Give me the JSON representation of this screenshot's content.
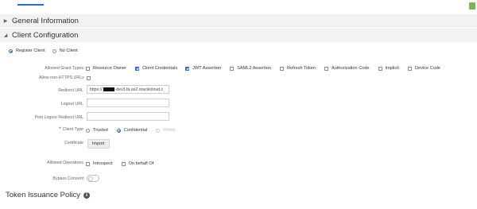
{
  "sections": {
    "general_information": "General Information",
    "client_configuration": "Client Configuration"
  },
  "client_mode": {
    "options": [
      {
        "label": "Register Client",
        "selected": true
      },
      {
        "label": "No Client",
        "selected": false
      }
    ]
  },
  "grant_types": {
    "label": "Allowed Grant Types",
    "options": [
      {
        "label": "Resource Owner",
        "checked": false
      },
      {
        "label": "Client Credentials",
        "checked": true
      },
      {
        "label": "JWT Assertion",
        "checked": true
      },
      {
        "label": "SAML2 Assertion",
        "checked": false
      },
      {
        "label": "Refresh Token",
        "checked": false
      },
      {
        "label": "Authorization Code",
        "checked": false
      },
      {
        "label": "Implicit",
        "checked": false
      },
      {
        "label": "Device Code",
        "checked": false
      }
    ]
  },
  "allow_non_https": {
    "label": "Allow non-HTTPS URLs",
    "checked": false
  },
  "redirect_url": {
    "label": "Redirect URL",
    "value_prefix": "https://",
    "value_suffix": "-dev3.fa.us2.oraclecloud.c"
  },
  "logout_url": {
    "label": "Logout URL",
    "value": ""
  },
  "post_logout_redirect_url": {
    "label": "Post Logout Redirect URL",
    "value": ""
  },
  "client_type": {
    "required_mark": "*",
    "label": "Client Type",
    "options": [
      {
        "label": "Trusted",
        "selected": false,
        "disabled": false
      },
      {
        "label": "Confidential",
        "selected": true,
        "disabled": false
      },
      {
        "label": "Public",
        "selected": false,
        "disabled": true
      }
    ]
  },
  "certificate": {
    "label": "Certificate",
    "button": "Import"
  },
  "allowed_operations": {
    "label": "Allowed Operations",
    "options": [
      {
        "label": "Introspect",
        "checked": false
      },
      {
        "label": "On behalf Of",
        "checked": false
      }
    ]
  },
  "bypass_consent": {
    "label": "Bypass Consent",
    "on": false
  },
  "token_issuance_policy": {
    "title": "Token Issuance Policy",
    "info_icon_glyph": "i"
  },
  "colors": {
    "accent": "#2b6fcf",
    "header_bg": "#f2f2f2",
    "badge": "#7ab55c"
  },
  "icons": {
    "collapsed": "triangle-right-icon",
    "expanded": "triangle-down-icon",
    "info": "info-icon"
  }
}
